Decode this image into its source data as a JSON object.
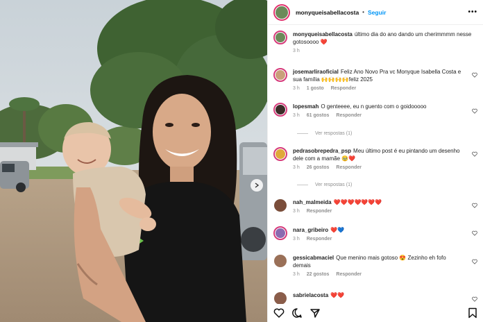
{
  "post": {
    "author": "monyqueisabellacosta",
    "separator": "•",
    "follow_label": "Seguir",
    "more_label": "•••"
  },
  "colors": {
    "accent": "#0095f6",
    "heart_red": "#e0245e",
    "meta_gray": "#8e8e8e"
  },
  "caption": {
    "user": "monyqueisabellacosta",
    "text": "último dia do ano dando um cherimmmm nesse gotosoooo ❤️",
    "time": "3 h"
  },
  "comments": [
    {
      "user": "josemarliraoficial",
      "text": "Feliz Ano Novo Pra vc Monyque Isabella Costa e sua família 🙌🙌🙌🙌feliz 2025",
      "time": "3 h",
      "likes": "1 gosto",
      "reply": "Responder"
    },
    {
      "user": "lopesmah",
      "text": "O genteeee, eu n guento com o goidooooo",
      "time": "3 h",
      "likes": "61 gostos",
      "reply": "Responder",
      "view_replies": "Ver respostas (1)"
    },
    {
      "user": "pedrasobrepedra_psp",
      "text": "Meu último post é eu pintando um desenho dele com a mamãe 🥹❤️",
      "time": "3 h",
      "likes": "26 gostos",
      "reply": "Responder",
      "view_replies": "Ver respostas (1)"
    },
    {
      "user": "nah_malmeida",
      "text": "❤️❤️❤️❤️❤️❤️❤️",
      "time": "3 h",
      "likes": "",
      "reply": "Responder"
    },
    {
      "user": "nara_gribeiro",
      "text": "❤️💙",
      "time": "3 h",
      "likes": "",
      "reply": "Responder"
    },
    {
      "user": "gessicabmaciel",
      "text": "Que menino mais gotoso 😍 Zezinho eh fofo demais",
      "time": "3 h",
      "likes": "22 gostos",
      "reply": "Responder"
    },
    {
      "user": "sabrielacosta",
      "text": "❤️❤️",
      "time": "",
      "likes": "",
      "reply": ""
    }
  ],
  "icons": {
    "like": "heart-icon",
    "comment": "comment-icon",
    "share": "share-icon",
    "save": "bookmark-icon",
    "next": "chevron-right-icon"
  }
}
